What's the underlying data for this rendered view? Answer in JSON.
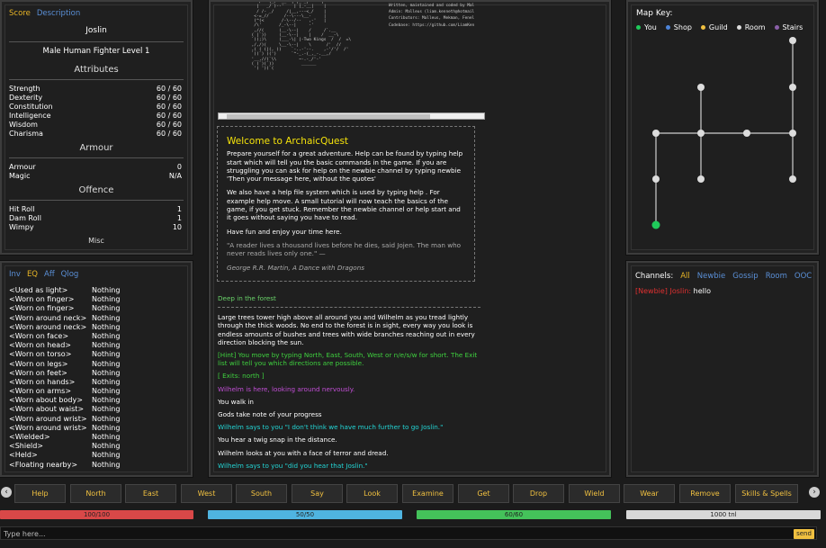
{
  "score_panel": {
    "tabs": [
      {
        "label": "Score",
        "active": true
      },
      {
        "label": "Description",
        "active": false
      }
    ],
    "name": "Joslin",
    "description": "Male Human Fighter Level 1",
    "attributes_title": "Attributes",
    "attributes": [
      {
        "label": "Strength",
        "value": "60 / 60"
      },
      {
        "label": "Dexterity",
        "value": "60 / 60"
      },
      {
        "label": "Constitution",
        "value": "60 / 60"
      },
      {
        "label": "Intelligence",
        "value": "60 / 60"
      },
      {
        "label": "Wisdom",
        "value": "60 / 60"
      },
      {
        "label": "Charisma",
        "value": "60 / 60"
      }
    ],
    "armour_title": "Armour",
    "armour": [
      {
        "label": "Armour",
        "value": "0"
      },
      {
        "label": "Magic",
        "value": "N/A"
      }
    ],
    "offence_title": "Offence",
    "offence": [
      {
        "label": "Hit Roll",
        "value": "1"
      },
      {
        "label": "Dam Roll",
        "value": "1"
      },
      {
        "label": "Wimpy",
        "value": "10"
      }
    ],
    "misc_title": "Misc"
  },
  "eq_panel": {
    "tabs": [
      {
        "label": "Inv",
        "active": false
      },
      {
        "label": "EQ",
        "active": true
      },
      {
        "label": "Aff",
        "active": false
      },
      {
        "label": "Qlog",
        "active": false
      }
    ],
    "items": [
      {
        "slot": "<Used as light>",
        "item": "Nothing"
      },
      {
        "slot": "<Worn on finger>",
        "item": "Nothing"
      },
      {
        "slot": "<Worn on finger>",
        "item": "Nothing"
      },
      {
        "slot": "<Worn around neck>",
        "item": "Nothing"
      },
      {
        "slot": "<Worn around neck>",
        "item": "Nothing"
      },
      {
        "slot": "<Worn on face>",
        "item": "Nothing"
      },
      {
        "slot": "<Worn on head>",
        "item": "Nothing"
      },
      {
        "slot": "<Worn on torso>",
        "item": "Nothing"
      },
      {
        "slot": "<Worn on legs>",
        "item": "Nothing"
      },
      {
        "slot": "<Worn on feet>",
        "item": "Nothing"
      },
      {
        "slot": "<Worn on hands>",
        "item": "Nothing"
      },
      {
        "slot": "<Worn on arms>",
        "item": "Nothing"
      },
      {
        "slot": "<Worn about body>",
        "item": "Nothing"
      },
      {
        "slot": "<Worn about waist>",
        "item": "Nothing"
      },
      {
        "slot": "<Worn around wrist>",
        "item": "Nothing"
      },
      {
        "slot": "<Worn around wrist>",
        "item": "Nothing"
      },
      {
        "slot": "<Wielded>",
        "item": "Nothing"
      },
      {
        "slot": "<Shield>",
        "item": "Nothing"
      },
      {
        "slot": "<Held>",
        "item": "Nothing"
      },
      {
        "slot": "<Floating nearby>",
        "item": "Nothing"
      }
    ]
  },
  "main": {
    "ascii_art": "     /'  (_/  __  | |_-_|     |\n    |   _/ )--'    | |_-__|    |\n    / /- _/     /|__,---<_/    |\n   <-=_//      /--\\---\\__-     |\n   (^(<       /-\\--/--   ,-'   |\n   /\\'       /_-\\--|     -'\n   ,//(      (__-\\--|    /     /`.__\n  ( |`))     (__-\\--|    |    /  __-\\\n  `));)\\     (___-\\| |-Two Kings  /  /  =\\\n  ,/,/)(     \\__-\\--|    \\      /'  //\n  ,( ( (|(, ))    `-..-'--.    ,-'/'/  /'\n  `)(`) )(')      `^-_.-(_,_-.__,/\n  '__,//(`\\\\         ~-.-_/'-'\n  ( (`)(`))           ______\n   ') ')(`(",
    "credits": "Written, maintained and coded by Mal\nAdmin: Malleus (liam.kenneth@hotmail\nContributors: Malleus, Mekman, Fenel\nCodebase: https://github.com/LiamKen",
    "welcome_title": "Welcome to ArchaicQuest",
    "welcome_p1": "Prepare yourself for a great adventure. Help can be found by typing help start which will tell you the basic commands in the game. If you are struggling you can ask for help on the newbie channel by typing newbie 'Then your message here, without the quotes'",
    "welcome_p2": "We also have a help file system which is used by typing help . For example help move. A small tutorial will now teach the basics of the game, if you get stuck. Remember the newbie channel or help start and it goes without saying you have to read.",
    "welcome_p3": "Have fun and enjoy your time here.",
    "quote": "\"A reader lives a thousand lives before he dies, said Jojen. The man who never reads lives only one.\" —",
    "quote_author": "George R.R. Martin, A Dance with Dragons",
    "room_title": "Deep in the forest",
    "room_desc": "Large trees tower high above all around you and Wilhelm as you tread lightly through the thick woods. No end to the forest is in sight, every way you look is endless amounts of bushes and trees with wide branches reaching out in every direction blocking the sun.",
    "hint": "[Hint] You move by typing North, East, South, West or n/e/s/w for short. The Exit list will tell you which directions are possible.",
    "exits": "[ Exits: north ]",
    "npc_here": "Wilhelm is here, looking around nervously.",
    "msg1": "You walk in",
    "msg2": "Gods take note of your progress",
    "say1": "Wilhelm says to you \"I don't think we have much further to go Joslin.\"",
    "msg3": "You hear a twig snap in the distance.",
    "msg4": "Wilhelm looks at you with a face of terror and dread.",
    "say2": "Wilhelm says to you \"did you hear that Joslin.\""
  },
  "map": {
    "title": "Map Key:",
    "legend": [
      {
        "label": "You",
        "color": "#1fca5a"
      },
      {
        "label": "Shop",
        "color": "#4d84d8"
      },
      {
        "label": "Guild",
        "color": "#f0c040"
      },
      {
        "label": "Room",
        "color": "#dddddd"
      },
      {
        "label": "Stairs",
        "color": "#8a5fa8"
      }
    ]
  },
  "channels": {
    "label": "Channels:",
    "tabs": [
      {
        "label": "All",
        "active": true
      },
      {
        "label": "Newbie",
        "active": false
      },
      {
        "label": "Gossip",
        "active": false
      },
      {
        "label": "Room",
        "active": false
      },
      {
        "label": "OOC",
        "active": false
      }
    ],
    "message": {
      "tag": "[Newbie]",
      "user": "Joslin:",
      "text": "hello"
    }
  },
  "buttons": [
    "Help",
    "North",
    "East",
    "West",
    "South",
    "Say",
    "Look",
    "Examine",
    "Get",
    "Drop",
    "Wield",
    "Wear",
    "Remove",
    "Skills & Spells"
  ],
  "scroll_left_icon": "‹",
  "scroll_right_icon": "›",
  "bars": [
    {
      "label": "100/100",
      "fraction": 1.0,
      "color": "#d94848"
    },
    {
      "label": "50/50",
      "fraction": 1.0,
      "color": "#4fb4e0"
    },
    {
      "label": "60/60",
      "fraction": 1.0,
      "color": "#44c25a"
    },
    {
      "label": "1000 tnl",
      "fraction": 1.0,
      "color": "#d8d8d8"
    }
  ],
  "input": {
    "placeholder": "Type here...",
    "send": "send"
  }
}
